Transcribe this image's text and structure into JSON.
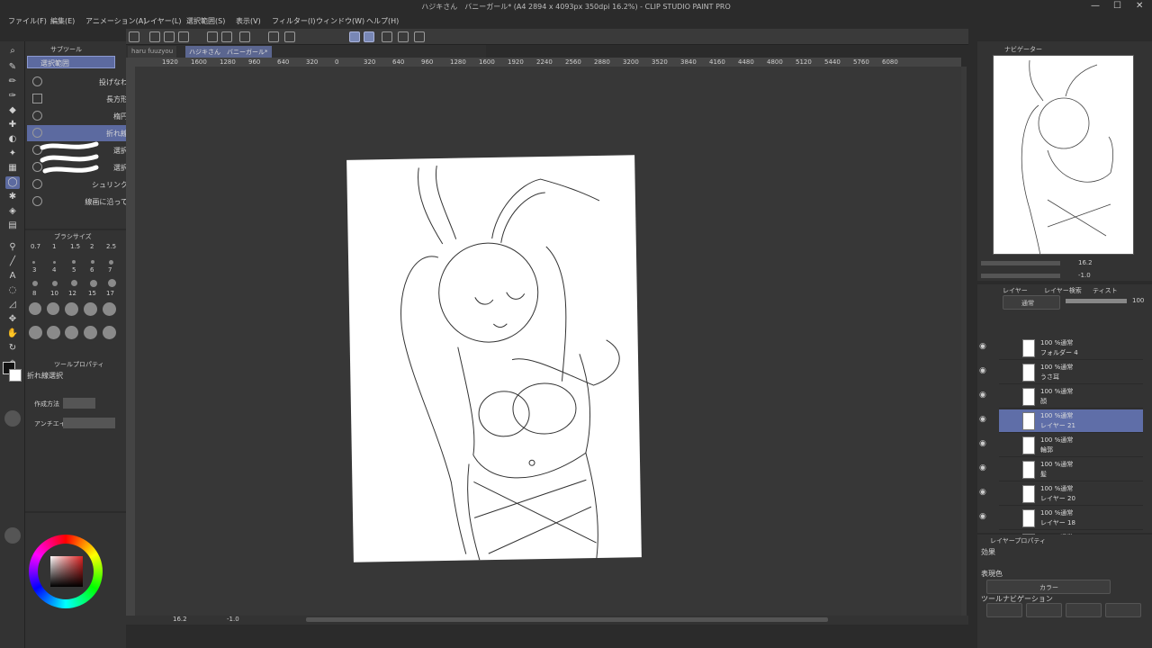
{
  "window": {
    "title": "ハジキさん　バニーガール* (A4 2894 x 4093px 350dpi 16.2%) - CLIP STUDIO PAINT PRO"
  },
  "menu": [
    "ファイル(F)",
    "編集(E)",
    "アニメーション(A)",
    "レイヤー(L)",
    "選択範囲(S)",
    "表示(V)",
    "フィルター(I)",
    "ウィンドウ(W)",
    "ヘルプ(H)"
  ],
  "doctabs": [
    "haru fuuzyou",
    "ハジキさん　バニーガール*"
  ],
  "ruler": [
    "1920",
    "1600",
    "1280",
    "960",
    "640",
    "320",
    "0",
    "320",
    "640",
    "960",
    "1280",
    "1600",
    "1920",
    "2240",
    "2560",
    "2880",
    "3200",
    "3520",
    "3840",
    "4160",
    "4480",
    "4800",
    "5120",
    "5440",
    "5760",
    "6080"
  ],
  "subtool": {
    "header": "サブツール",
    "group": "選択範囲",
    "items": [
      "投げなわ選択",
      "長方形選択",
      "楕円選択",
      "折れ線選択",
      "選択ペン",
      "選択消し",
      "シュリンク選択",
      "線画に沿って選択"
    ],
    "selected": "折れ線選択"
  },
  "brushsize": {
    "header": "ブラシサイズ",
    "row1": [
      "0.7",
      "1",
      "1.5",
      "2",
      "2.5"
    ],
    "row2": [
      "3",
      "4",
      "5",
      "6",
      "7"
    ],
    "row3": [
      "8",
      "10",
      "12",
      "15",
      "17"
    ]
  },
  "toolprop": {
    "header": "ツールプロパティ",
    "toolname": "折れ線選択",
    "row1": "作成方法",
    "row2": "アンチエイ"
  },
  "status": {
    "zoom": "16.2",
    "angle": "-1.0"
  },
  "navigator": {
    "header": "ナビゲーター",
    "zoom": "16.2",
    "angle": "-1.0"
  },
  "layers": {
    "tabs": [
      "レイヤー",
      "レイヤー検索",
      "ティスト"
    ],
    "blend": "通常",
    "opacity": "100",
    "items": [
      {
        "mode": "100 %通常",
        "name": "フォルダー 4"
      },
      {
        "mode": "100 %通常",
        "name": "うさ耳"
      },
      {
        "mode": "100 %通常",
        "name": "顔"
      },
      {
        "mode": "100 %通常",
        "name": "レイヤー 21"
      },
      {
        "mode": "100 %通常",
        "name": "輪郭"
      },
      {
        "mode": "100 %通常",
        "name": "髪"
      },
      {
        "mode": "100 %通常",
        "name": "レイヤー 20"
      },
      {
        "mode": "100 %通常",
        "name": "レイヤー 18"
      },
      {
        "mode": "100 %通常",
        "name": ""
      }
    ],
    "selected_index": 3
  },
  "layerprop": {
    "header": "レイヤープロパティ",
    "effect": "効果",
    "expression": "表現色",
    "color": "カラー",
    "toolnav": "ツールナビゲーション"
  },
  "colors": {
    "accent": "#5c6aa0",
    "bg": "#2b2b2b",
    "panel": "#333333"
  }
}
